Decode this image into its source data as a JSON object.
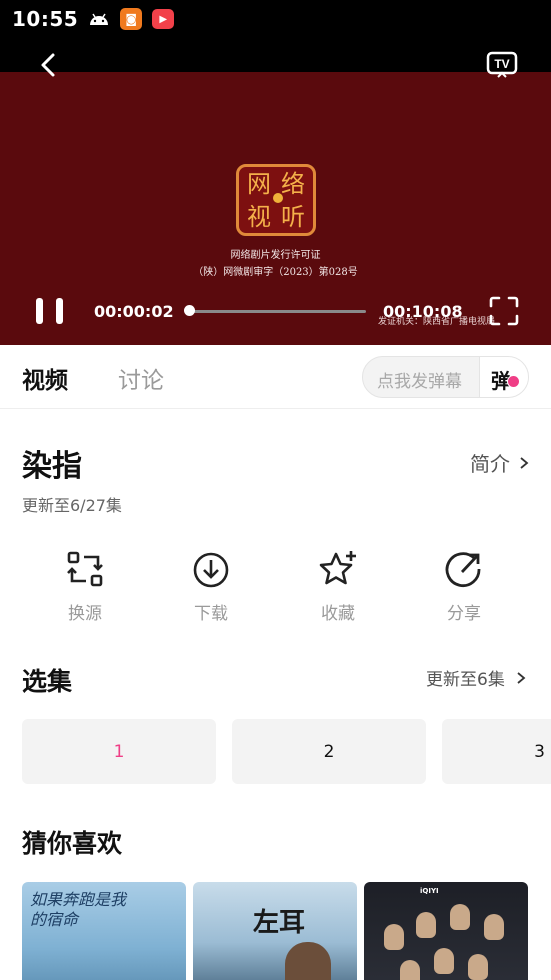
{
  "status_bar": {
    "time": "10:55",
    "icons": [
      "android-icon",
      "app-badge-icon",
      "tv-app-icon"
    ]
  },
  "player": {
    "license_line1": "网络剧片发行许可证",
    "license_line2": "（陕）网微剧审字（2023）第028号",
    "issuer": "发证机关：陕西省广播电视局",
    "current_time": "00:00:02",
    "total_time": "00:10:08",
    "progress": 0.0033,
    "seal_chars": [
      "网",
      "络",
      "视",
      "听"
    ]
  },
  "tabs": {
    "video": "视频",
    "discussion": "讨论"
  },
  "danmu": {
    "placeholder": "点我发弹幕",
    "button": "弹"
  },
  "show": {
    "title": "染指",
    "intro_label": "简介",
    "update_status": "更新至6/27集"
  },
  "actions": [
    {
      "label": "换源",
      "icon": "switch-source-icon"
    },
    {
      "label": "下载",
      "icon": "download-icon"
    },
    {
      "label": "收藏",
      "icon": "favorite-star-icon"
    },
    {
      "label": "分享",
      "icon": "share-icon"
    }
  ],
  "episodes": {
    "title": "选集",
    "update_label": "更新至6集",
    "items": [
      "1",
      "2",
      "3"
    ],
    "selected": "1"
  },
  "recommend": {
    "title": "猜你喜欢",
    "poster1_text": "如果奔跑是我的宿命",
    "poster2_text": "左耳",
    "poster3_badge": "iQIYI"
  },
  "colors": {
    "accent": "#ef3e86",
    "player_bg": "#5a0a0d"
  }
}
